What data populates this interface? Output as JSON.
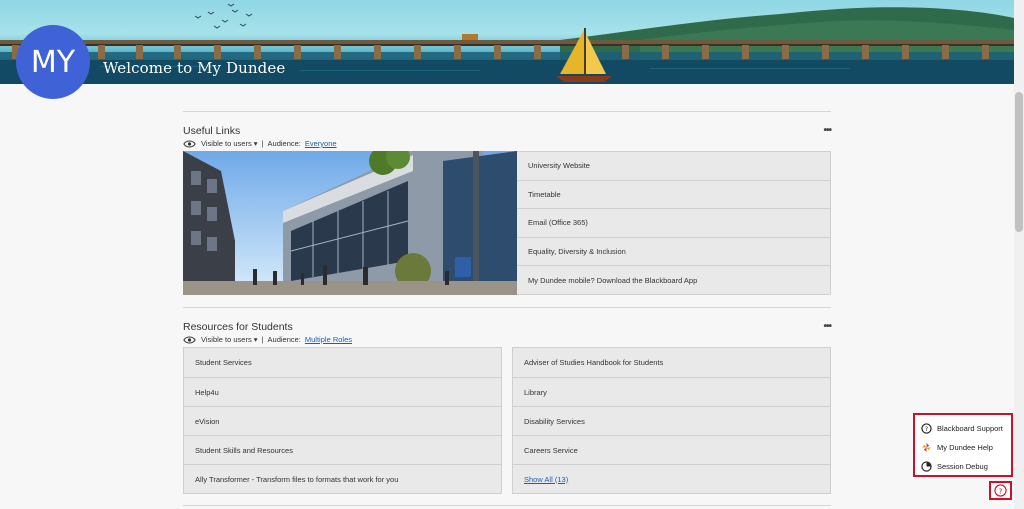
{
  "banner": {
    "logo_text": "MY",
    "title": "Welcome to My Dundee"
  },
  "useful_links": {
    "title": "Useful Links",
    "visibility": "Visible to users ▾",
    "audience_label": "Audience:",
    "audience_value": "Everyone",
    "more": "•••",
    "links": [
      {
        "label": "University Website"
      },
      {
        "label": "Timetable"
      },
      {
        "label": "Email (Office 365)"
      },
      {
        "label": "Equality, Diversity & Inclusion"
      },
      {
        "label": "My Dundee mobile? Download the Blackboard App"
      }
    ]
  },
  "resources": {
    "title": "Resources for Students",
    "visibility": "Visible to users ▾",
    "audience_label": "Audience:",
    "audience_value": "Multiple Roles",
    "more": "•••",
    "left": [
      {
        "label": "Student Services"
      },
      {
        "label": "Help4u"
      },
      {
        "label": "eVision"
      },
      {
        "label": "Student Skills and Resources"
      },
      {
        "label": "Ally Transformer - Transform files to formats that work for you"
      }
    ],
    "right": [
      {
        "label": "Adviser of Studies Handbook for Students"
      },
      {
        "label": "Library"
      },
      {
        "label": "Disability Services"
      },
      {
        "label": "Careers Service"
      },
      {
        "label": "Show All (13)"
      }
    ]
  },
  "help_menu": {
    "items": [
      {
        "label": "Blackboard Support",
        "icon": "question-bubble-icon"
      },
      {
        "label": "My Dundee Help",
        "icon": "pinwheel-icon"
      },
      {
        "label": "Session Debug",
        "icon": "clock-icon"
      }
    ]
  },
  "colors": {
    "logo": "#3f62d6",
    "link": "#1a5fb4",
    "highlight": "#d0102a"
  }
}
